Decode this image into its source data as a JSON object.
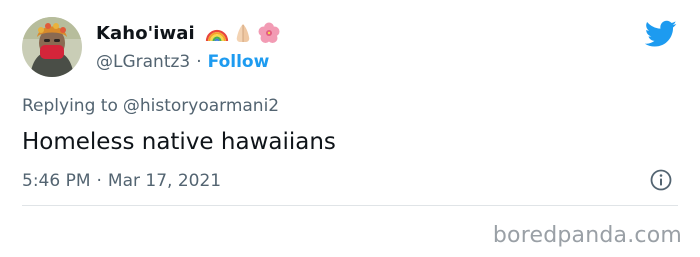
{
  "tweet": {
    "display_name": "Kaho'iwai",
    "name_emojis": [
      "rainbow-icon",
      "folded-hands-icon",
      "hibiscus-icon"
    ],
    "handle": "@LGrantz3",
    "separator": "·",
    "follow_label": "Follow",
    "reply_prefix": "Replying to",
    "reply_handle": "@historyoarmani2",
    "text": "Homeless native hawaiians",
    "time": "5:46 PM",
    "date": "Mar 17, 2021"
  },
  "watermark": {
    "text": "boredpanda.com"
  },
  "colors": {
    "accent": "#1d9bf0",
    "text_primary": "#0f1419",
    "text_secondary": "#536471",
    "divider": "#e0e4e7",
    "watermark": "#9aa0a6"
  }
}
